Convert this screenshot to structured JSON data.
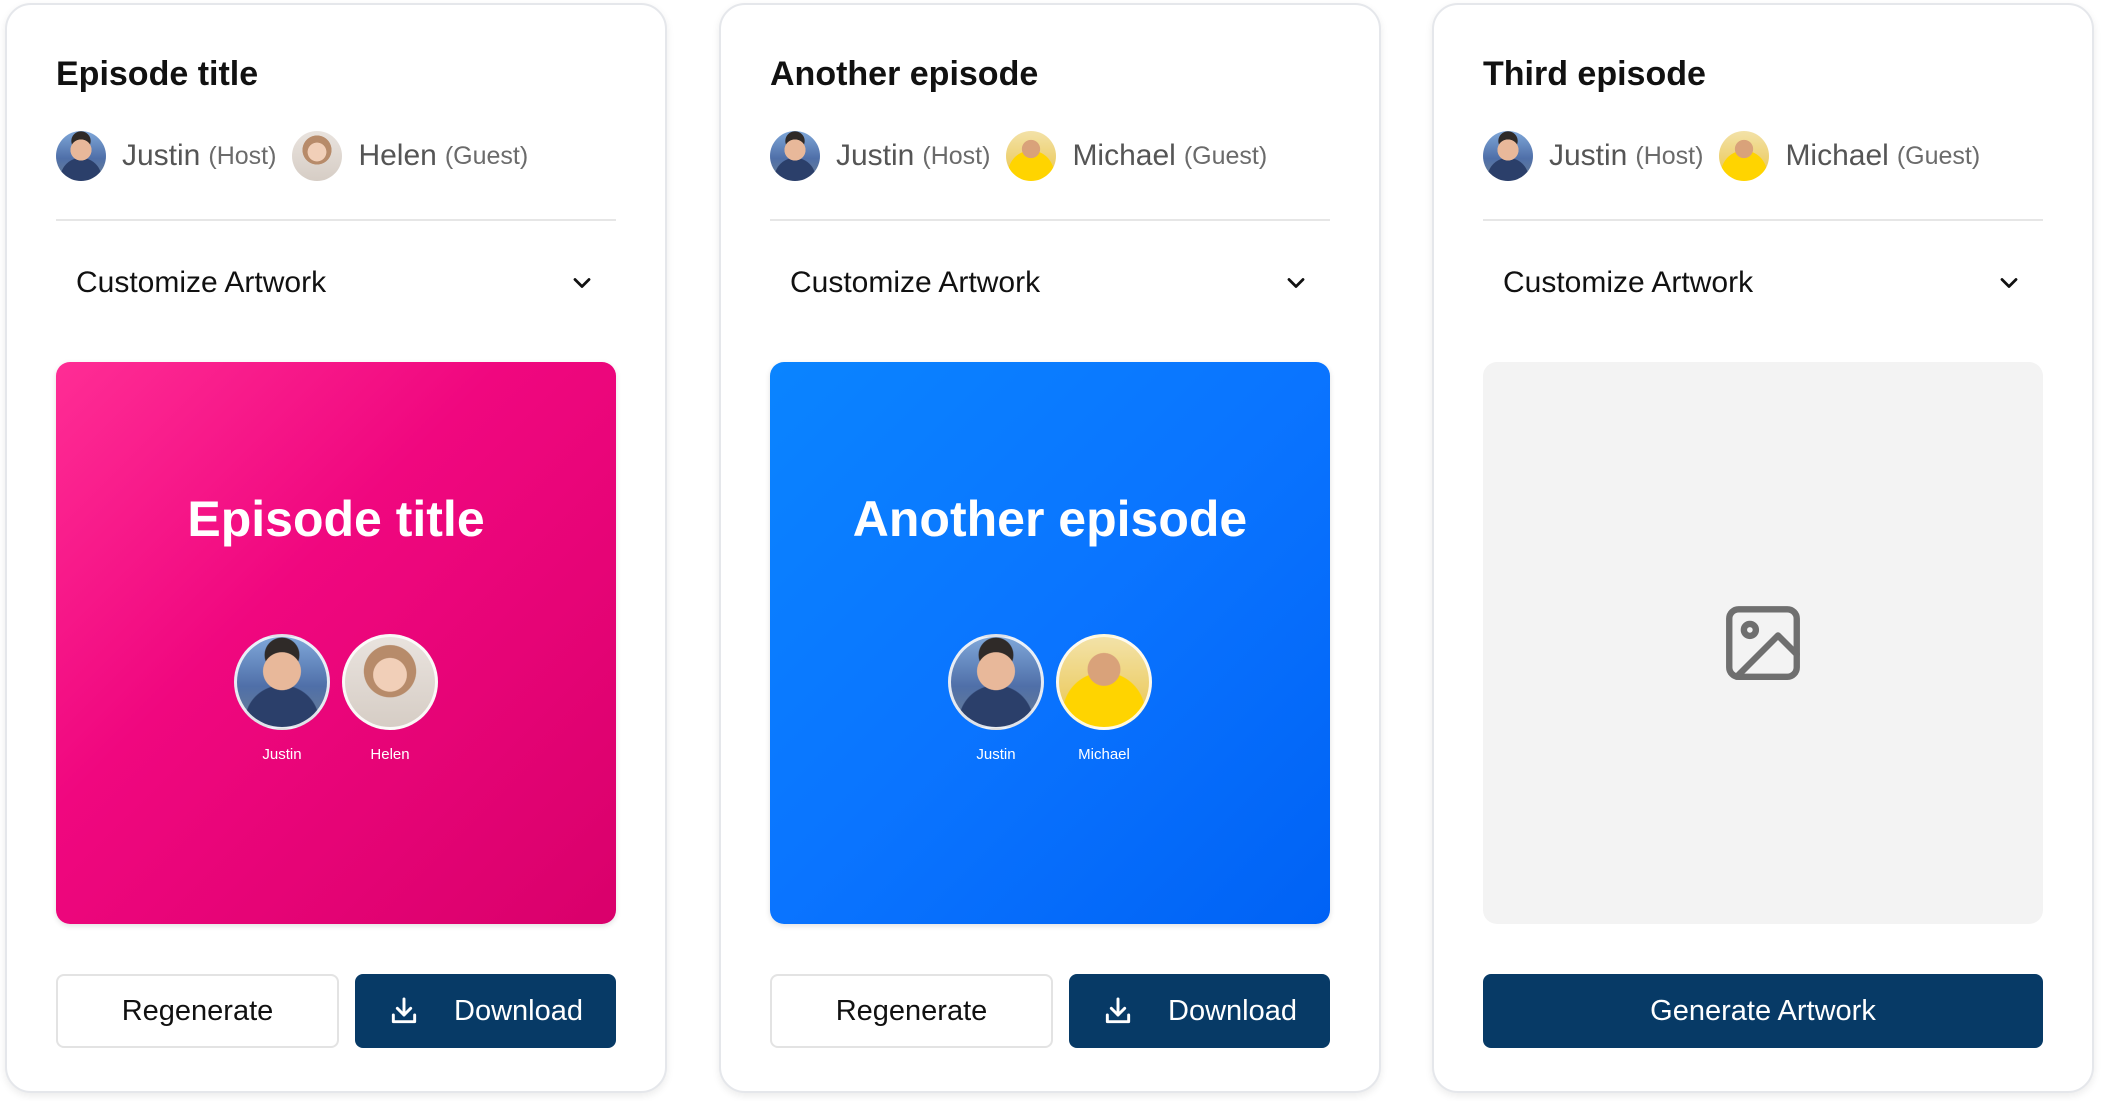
{
  "cards": [
    {
      "title": "Episode title",
      "people": [
        {
          "name": "Justin",
          "role": "(Host)",
          "avatar": "justin-avatar"
        },
        {
          "name": "Helen",
          "role": "(Guest)",
          "avatar": "helen-avatar"
        }
      ],
      "customize_label": "Customize Artwork",
      "artwork": {
        "state": "generated",
        "background": "#f0077f",
        "title": "Episode title",
        "names": [
          "Justin",
          "Helen"
        ]
      },
      "buttons": {
        "regenerate": "Regenerate",
        "download": "Download"
      }
    },
    {
      "title": "Another episode",
      "people": [
        {
          "name": "Justin",
          "role": "(Host)",
          "avatar": "justin-avatar"
        },
        {
          "name": "Michael",
          "role": "(Guest)",
          "avatar": "michael-avatar"
        }
      ],
      "customize_label": "Customize Artwork",
      "artwork": {
        "state": "generated",
        "background": "#0a74ff",
        "title": "Another episode",
        "names": [
          "Justin",
          "Michael"
        ]
      },
      "buttons": {
        "regenerate": "Regenerate",
        "download": "Download"
      }
    },
    {
      "title": "Third episode",
      "people": [
        {
          "name": "Justin",
          "role": "(Host)",
          "avatar": "justin-avatar"
        },
        {
          "name": "Michael",
          "role": "(Guest)",
          "avatar": "michael-avatar"
        }
      ],
      "customize_label": "Customize Artwork",
      "artwork": {
        "state": "empty",
        "placeholder_icon": "image-placeholder-icon"
      },
      "buttons": {
        "generate": "Generate Artwork"
      }
    }
  ],
  "colors": {
    "primary_button": "#073a66",
    "pink_art": "#f0077f",
    "blue_art": "#0a74ff",
    "empty_art": "#f3f3f3"
  },
  "icons": {
    "chevron": "chevron-down-icon",
    "download": "download-icon",
    "placeholder": "image-placeholder-icon"
  }
}
